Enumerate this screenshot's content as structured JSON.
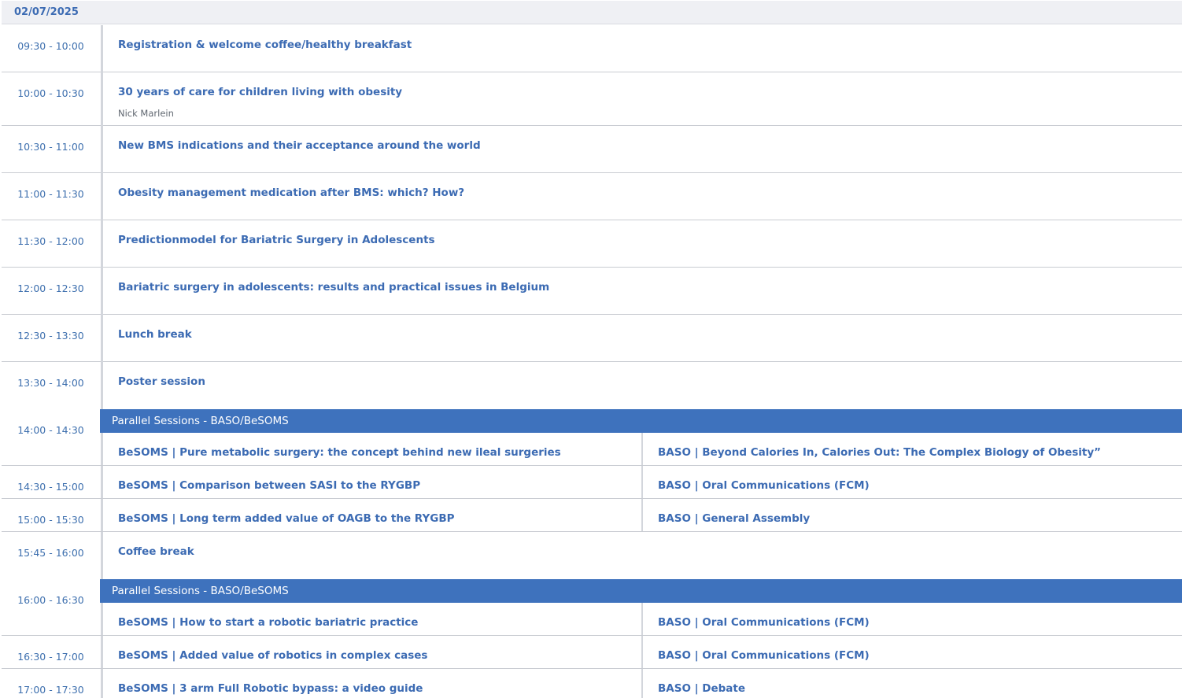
{
  "date": "02/07/2025",
  "single_sessions": [
    {
      "time": "09:30 - 10:00",
      "title": "Registration & welcome coffee/healthy breakfast",
      "speaker": ""
    },
    {
      "time": "10:00 - 10:30",
      "title": "30 years of care for children living with obesity",
      "speaker": "Nick Marlein"
    },
    {
      "time": "10:30 - 11:00",
      "title": "New BMS indications and their acceptance around the world",
      "speaker": ""
    },
    {
      "time": "11:00 - 11:30",
      "title": "Obesity management medication after BMS: which? How?",
      "speaker": ""
    },
    {
      "time": "11:30 - 12:00",
      "title": "Predictionmodel for Bariatric Surgery in Adolescents",
      "speaker": ""
    },
    {
      "time": "12:00 - 12:30",
      "title": "Bariatric surgery in adolescents: results and practical issues in Belgium",
      "speaker": ""
    },
    {
      "time": "12:30 - 13:30",
      "title": "Lunch break",
      "speaker": ""
    },
    {
      "time": "13:30 - 14:00",
      "title": "Poster session",
      "speaker": ""
    }
  ],
  "parallel_block_1": {
    "header": "Parallel Sessions - BASO/BeSOMS",
    "rows": [
      {
        "time": "14:00 - 14:30",
        "left": "BeSOMS | Pure metabolic surgery: the concept behind new ileal surgeries",
        "right": "BASO | Beyond Calories In, Calories Out: The Complex Biology of Obesity”"
      },
      {
        "time": "14:30 - 15:00",
        "left": "BeSOMS | Comparison between SASI to the RYGBP",
        "right": "BASO | Oral Communications (FCM)"
      },
      {
        "time": "15:00 - 15:30",
        "left": "BeSOMS | Long term added value of OAGB to the RYGBP",
        "right": "BASO | General Assembly"
      }
    ]
  },
  "coffee_break": {
    "time": "15:45 - 16:00",
    "title": "Coffee break"
  },
  "parallel_block_2": {
    "header": "Parallel Sessions - BASO/BeSOMS",
    "rows": [
      {
        "time": "16:00 - 16:30",
        "left": "BeSOMS | How to start a robotic bariatric practice",
        "right": "BASO | Oral Communications (FCM)"
      },
      {
        "time": "16:30 - 17:00",
        "left": "BeSOMS | Added value of robotics in complex cases",
        "right": "BASO | Oral Communications (FCM)"
      },
      {
        "time": "17:00 - 17:30",
        "left": "BeSOMS | 3 arm Full Robotic bypass: a video guide",
        "right": "BASO | Debate"
      }
    ]
  }
}
